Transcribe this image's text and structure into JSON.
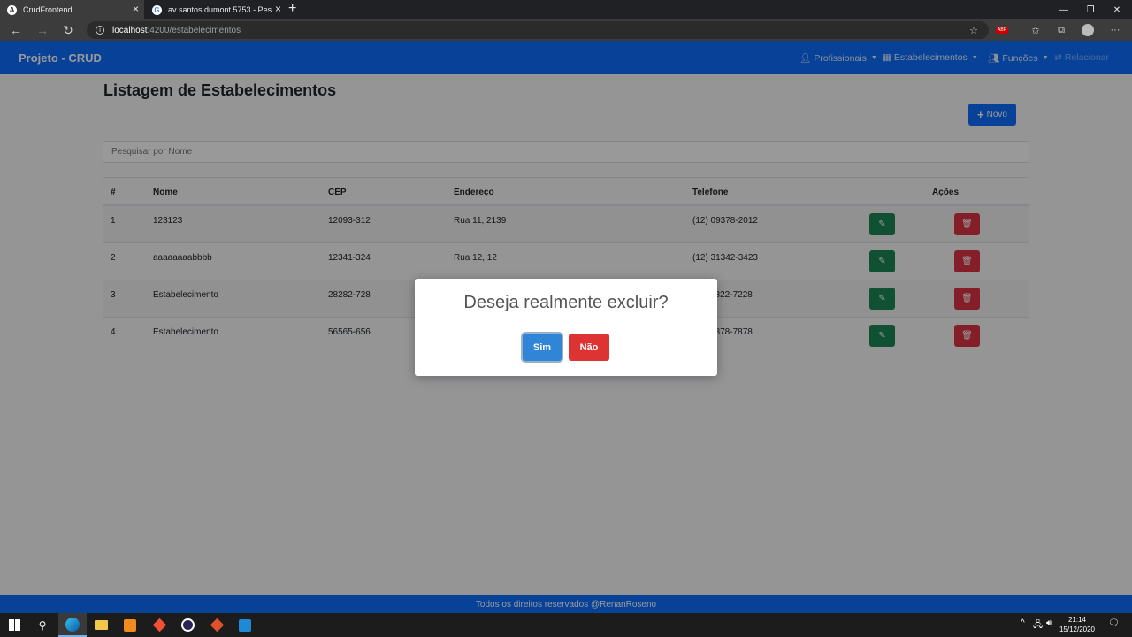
{
  "browser": {
    "tabs": [
      {
        "title": "CrudFrontend",
        "icon": "angular-icon"
      },
      {
        "title": "av santos dumont 5753 - Pesqu",
        "icon": "google-icon"
      }
    ],
    "new_tab": "+",
    "url_host": "localhost",
    "url_path": ":4200/estabelecimentos"
  },
  "app": {
    "brand": "Projeto - CRUD",
    "nav": {
      "profissionais": "Profissionais",
      "estabelecimentos": "Estabelecimentos",
      "funcoes": "Funções",
      "relacionar": "Relacionar"
    },
    "page_title": "Listagem de Estabelecimentos",
    "new_button": "Novo",
    "search_placeholder": "Pesquisar por Nome",
    "table": {
      "headers": [
        "#",
        "Nome",
        "CEP",
        "Endereço",
        "Telefone",
        "Ações"
      ],
      "rows": [
        {
          "id": "1",
          "nome": "123123",
          "cep": "12093-312",
          "endereco": "Rua 11, 2139",
          "telefone": "(12) 09378-2012"
        },
        {
          "id": "2",
          "nome": "aaaaaaaabbbb",
          "cep": "12341-324",
          "endereco": "Rua 12, 12",
          "telefone": "(12) 31342-3423"
        },
        {
          "id": "3",
          "nome": "Estabelecimento",
          "cep": "28282-728",
          "endereco": "",
          "telefone": "2822-7228"
        },
        {
          "id": "4",
          "nome": "Estabelecimento",
          "cep": "56565-656",
          "endereco": "",
          "telefone": "7878-7878"
        }
      ]
    },
    "footer": "Todos os direitos reservados @RenanRoseno"
  },
  "modal": {
    "title": "Deseja realmente excluir?",
    "confirm": "Sim",
    "cancel": "Não"
  },
  "taskbar": {
    "time": "21:14",
    "date": "15/12/2020"
  },
  "colors": {
    "primary": "#0d6efd",
    "success": "#198754",
    "danger": "#dc3545",
    "confirm": "#3085d6",
    "cancel": "#dd3333"
  }
}
